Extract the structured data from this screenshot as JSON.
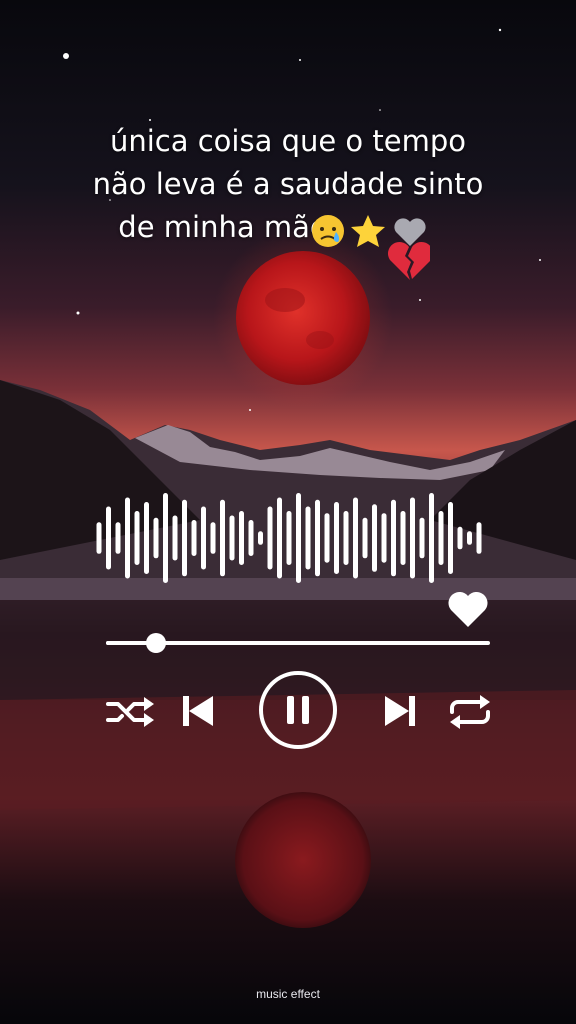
{
  "overlay": {
    "caption_lines": [
      "única coisa que o tempo",
      "não leva é a saudade sinto",
      "de minha mãe"
    ],
    "emojis": [
      "crying-face",
      "star",
      "grey-heart",
      "broken-heart"
    ]
  },
  "player": {
    "progress": 0.13,
    "state": "playing",
    "liked": true,
    "waveform": [
      0.35,
      0.7,
      0.35,
      0.9,
      0.6,
      0.8,
      0.45,
      1.0,
      0.5,
      0.85,
      0.4,
      0.7,
      0.35,
      0.85,
      0.5,
      0.6,
      0.4,
      0.15,
      0.7,
      0.9,
      0.6,
      1.0,
      0.7,
      0.85,
      0.55,
      0.8,
      0.6,
      0.9,
      0.45,
      0.75,
      0.55,
      0.85,
      0.6,
      0.9,
      0.45,
      1.0,
      0.6,
      0.8,
      0.25,
      0.15,
      0.35
    ]
  },
  "footer": {
    "label": "music effect"
  },
  "colors": {
    "moon": "#c0191b",
    "sky_glow": "#d9534a",
    "controls": "#ffffff"
  }
}
